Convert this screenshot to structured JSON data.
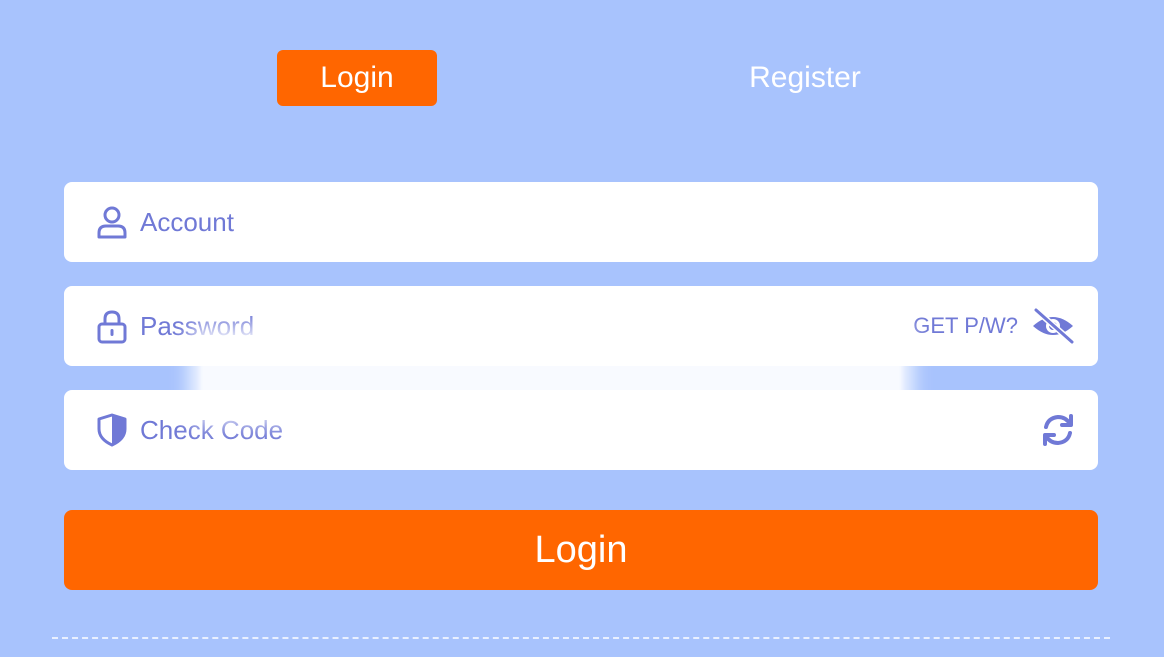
{
  "tabs": {
    "login_label": "Login",
    "register_label": "Register"
  },
  "account": {
    "placeholder": "Account",
    "icon": "user-icon"
  },
  "password": {
    "placeholder": "Password",
    "icon": "lock-icon",
    "get_pw_label": "GET P/W?",
    "toggle_icon": "eye-slash-icon"
  },
  "check_code": {
    "placeholder": "Check Code",
    "icon": "shield-icon",
    "refresh_icon": "refresh-icon"
  },
  "submit": {
    "label": "Login"
  },
  "colors": {
    "background": "#a8c3fd",
    "accent": "#ff6600",
    "icon": "#7079d6",
    "field": "#ffffff"
  }
}
